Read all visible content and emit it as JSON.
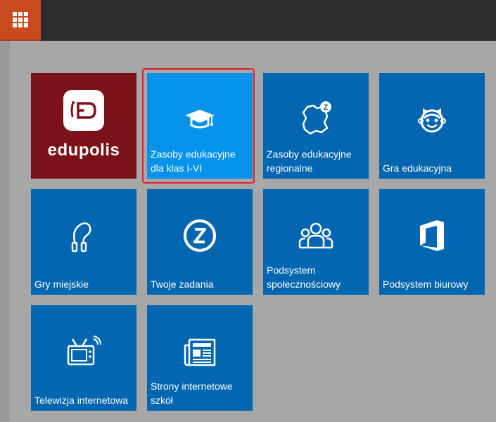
{
  "header": {
    "apps_button_icon": "grid-icon"
  },
  "tiles": [
    {
      "name": "edupolis",
      "logo_text": "edupolis",
      "icon": "edupolis-logo"
    },
    {
      "name": "edu-resources-1-6",
      "label": "Zasoby edukacyjne dla klas I-VI",
      "icon": "graduation-cap-icon",
      "active": true
    },
    {
      "name": "edu-resources-regional",
      "label": "Zasoby edukacyjne regionalne",
      "icon": "region-map-icon"
    },
    {
      "name": "edu-game",
      "label": "Gra edukacyjna",
      "icon": "child-face-icon"
    },
    {
      "name": "city-games",
      "label": "Gry miejskie",
      "icon": "jump-rope-icon"
    },
    {
      "name": "your-tasks",
      "label": "Twoje zadania",
      "icon": "z-circle-icon"
    },
    {
      "name": "social-subsystem",
      "label": "Podsystem społecznościowy",
      "icon": "people-group-icon"
    },
    {
      "name": "office-subsystem",
      "label": "Podsystem biurowy",
      "icon": "office-icon"
    },
    {
      "name": "internet-tv",
      "label": "Telewizja internetowa",
      "icon": "tv-icon"
    },
    {
      "name": "school-websites",
      "label": "Strony internetowe szkół",
      "icon": "newspaper-icon"
    }
  ],
  "colors": {
    "accent": "#c84a1e",
    "tile": "#0266b0",
    "tile_active": "#0592ea",
    "edupolis": "#7b1219",
    "highlight": "#e0202a"
  }
}
